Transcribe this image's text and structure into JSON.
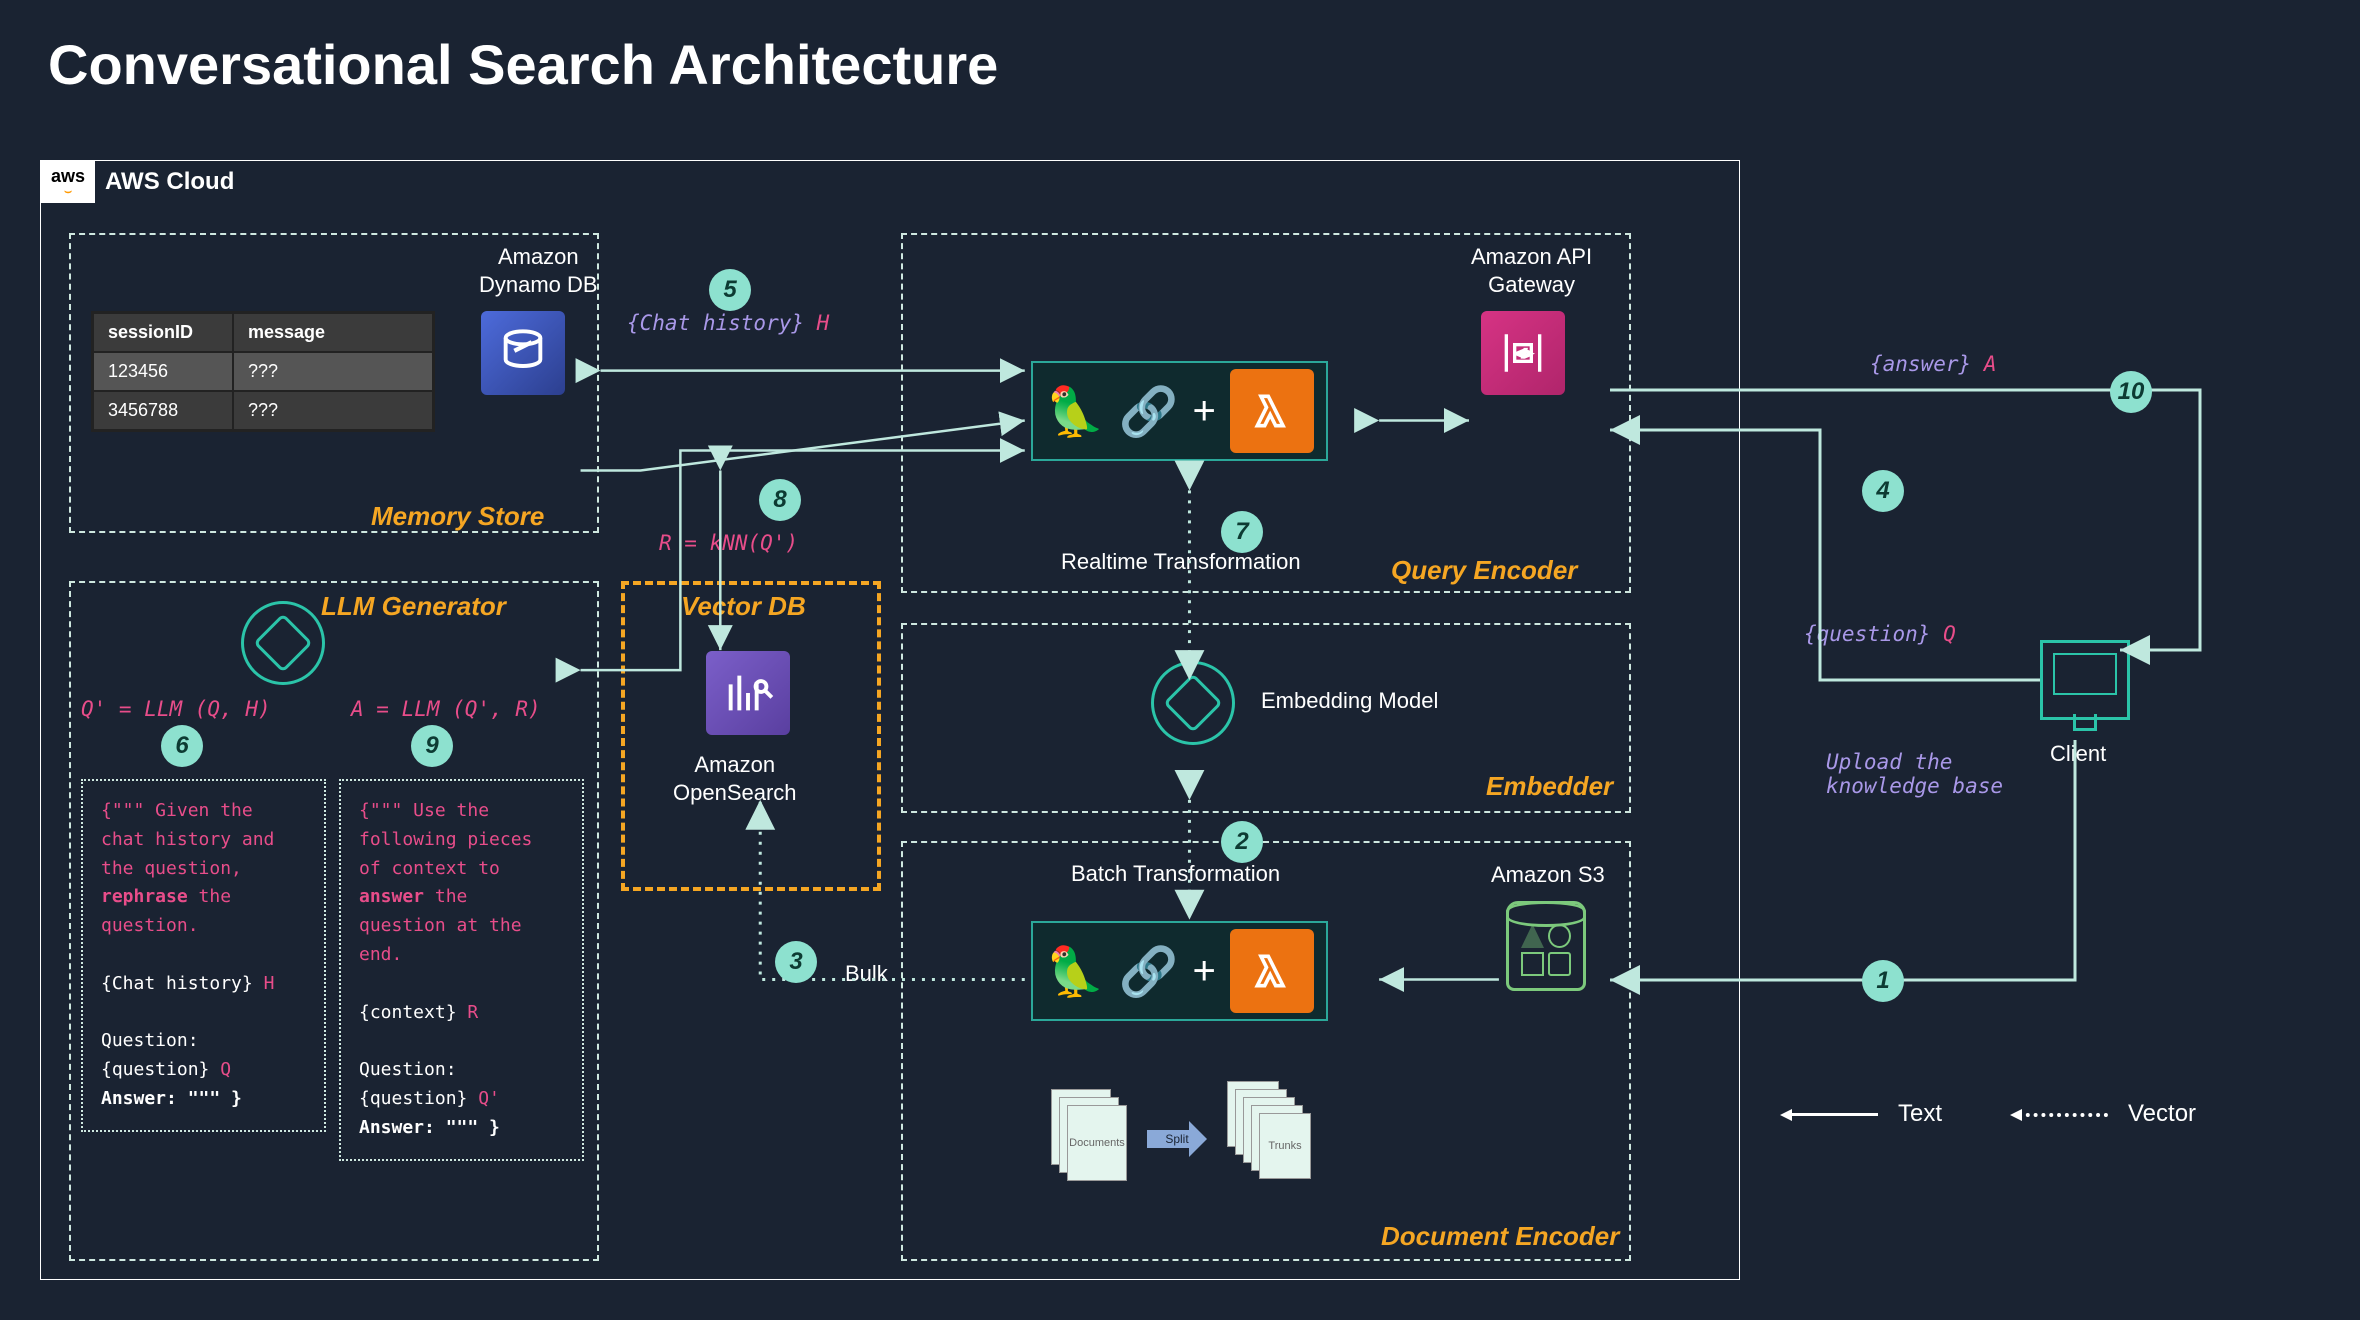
{
  "title": "Conversational Search Architecture",
  "cloud": {
    "label": "AWS Cloud",
    "badge": "aws"
  },
  "sections": {
    "memory_store": "Memory Store",
    "llm_generator": "LLM Generator",
    "vector_db_title": "Vector DB",
    "query_encoder": "Query Encoder",
    "embedder": "Embedder",
    "document_encoder": "Document Encoder"
  },
  "services": {
    "dynamo": "Amazon\nDynamo DB",
    "opensearch": "Amazon\nOpenSearch",
    "api_gateway": "Amazon API\nGateway",
    "s3": "Amazon S3",
    "embedding_model": "Embedding Model",
    "client": "Client"
  },
  "memory_table": {
    "headers": [
      "sessionID",
      "message"
    ],
    "rows": [
      [
        "123456",
        "???"
      ],
      [
        "3456788",
        "???"
      ]
    ]
  },
  "steps": {
    "1": "1",
    "2": "2",
    "3": "3",
    "4": "4",
    "5": "5",
    "6": "6",
    "7": "7",
    "8": "8",
    "9": "9",
    "10": "10"
  },
  "formulas": {
    "step5_label": "{Chat history}",
    "step5_var": "H",
    "step6": "Q' = LLM (Q, H)",
    "step7": "Realtime Transformation",
    "step8": "R = kNN(Q')",
    "step9": "A = LLM (Q', R)",
    "batch": "Batch Transformation",
    "bulk": "Bulk",
    "answer_label": "{answer}",
    "answer_var": "A",
    "question_label": "{question}",
    "question_var": "Q",
    "upload": "Upload the\nknowledge base"
  },
  "prompts": {
    "p6": {
      "l1": "{\"\"\" Given the",
      "l2": "chat history and",
      "l3a": "the question,",
      "l4a": "rephrase",
      "l4b": " the",
      "l5": "question.",
      "l7a": "{Chat history}",
      "l7b": "H",
      "l9": "Question:",
      "l10a": "{question}",
      "l10b": "Q",
      "l11": "Answer: \"\"\" }"
    },
    "p9": {
      "l1": "{\"\"\" Use the",
      "l2": "following pieces",
      "l3": "of context to",
      "l4a": "answer",
      "l4b": " the",
      "l5": "question at the",
      "l6": "end.",
      "l8a": "{context}",
      "l8b": "R",
      "l10": "Question:",
      "l11a": "{question}",
      "l11b": "Q'",
      "l12": "Answer: \"\"\" }"
    }
  },
  "docs": {
    "documents": "Documents",
    "split": "Split",
    "trunks": "Trunks"
  },
  "legend": {
    "text": "Text",
    "vector": "Vector"
  }
}
